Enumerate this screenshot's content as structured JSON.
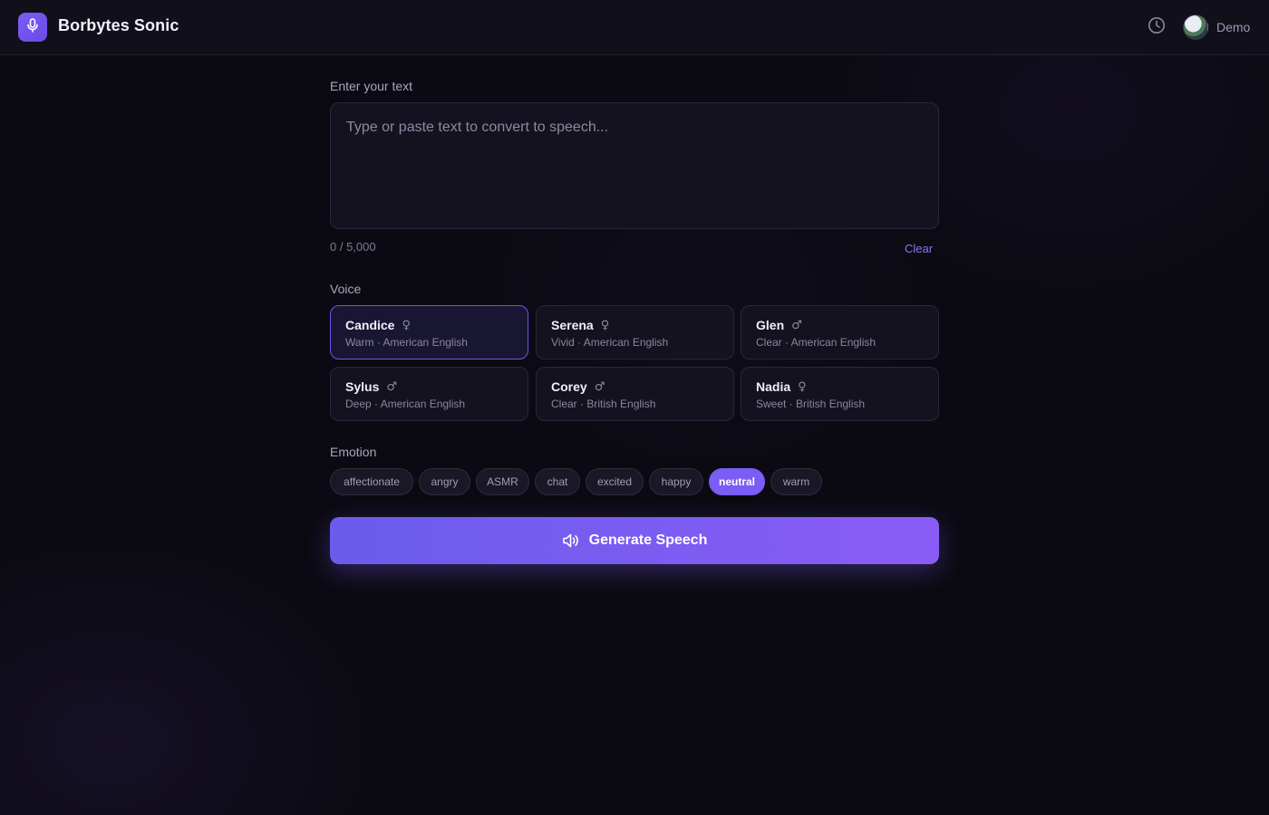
{
  "app": {
    "title": "Borbytes Sonic",
    "logo_icon": "microphone-icon",
    "accent_color": "#7b5cf5"
  },
  "header": {
    "history_icon": "clock-icon",
    "user_name": "Demo"
  },
  "text_input": {
    "label": "Enter your text",
    "placeholder": "Type or paste text to convert to speech...",
    "value": "",
    "char_count": "0 / 5,000",
    "clear_label": "Clear"
  },
  "voice": {
    "label": "Voice",
    "selected": "Candice",
    "options": [
      {
        "name": "Candice",
        "gender_icon": "♀",
        "description": "Warm · American English"
      },
      {
        "name": "Serena",
        "gender_icon": "♀",
        "description": "Vivid · American English"
      },
      {
        "name": "Glen",
        "gender_icon": "♂",
        "description": "Clear · American English"
      },
      {
        "name": "Sylus",
        "gender_icon": "♂",
        "description": "Deep · American English"
      },
      {
        "name": "Corey",
        "gender_icon": "♂",
        "description": "Clear · British English"
      },
      {
        "name": "Nadia",
        "gender_icon": "♀",
        "description": "Sweet · British English"
      }
    ]
  },
  "emotion": {
    "label": "Emotion",
    "selected": "neutral",
    "options": [
      "affectionate",
      "angry",
      "ASMR",
      "chat",
      "excited",
      "happy",
      "neutral",
      "warm"
    ]
  },
  "generate": {
    "label": "Generate Speech",
    "icon": "speaker-icon"
  }
}
